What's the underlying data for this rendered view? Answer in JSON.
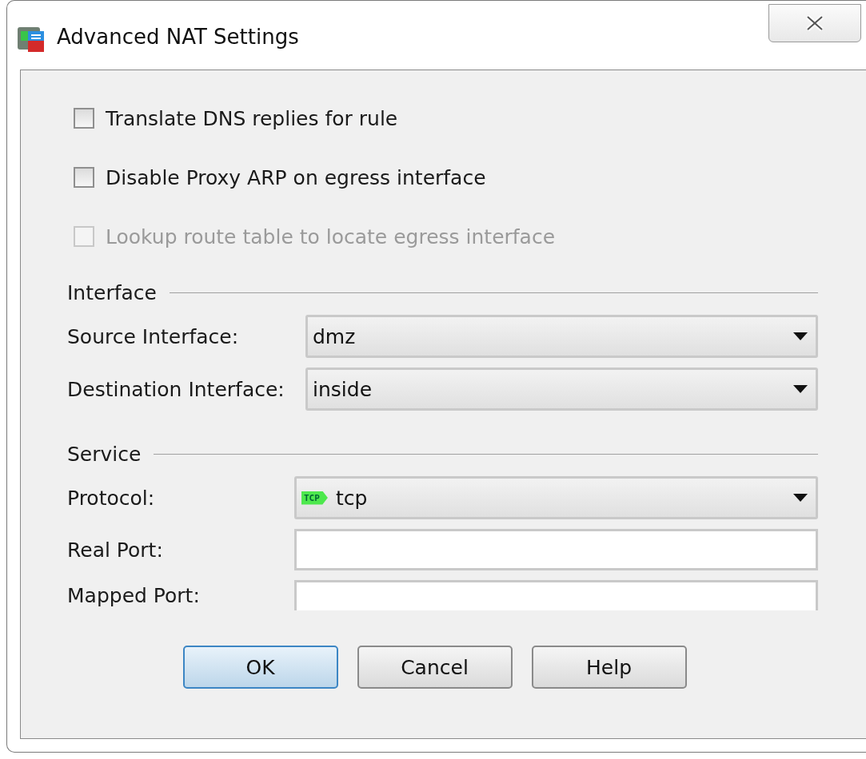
{
  "window": {
    "title": "Advanced NAT Settings"
  },
  "options": [
    {
      "label": "Translate DNS replies for rule",
      "checked": false,
      "disabled": false
    },
    {
      "label": "Disable Proxy ARP on egress interface",
      "checked": false,
      "disabled": false
    },
    {
      "label": "Lookup route table to locate egress interface",
      "checked": false,
      "disabled": true
    }
  ],
  "sections": [
    {
      "title": "Interface",
      "fields": [
        {
          "kind": "combo",
          "label": "Source Interface:",
          "value": "dmz"
        },
        {
          "kind": "combo",
          "label": "Destination Interface:",
          "value": "inside"
        }
      ]
    },
    {
      "title": "Service",
      "fields": [
        {
          "kind": "combo",
          "label": "Protocol:",
          "value": "tcp",
          "badge": "TCP"
        },
        {
          "kind": "text",
          "label": "Real Port:"
        },
        {
          "kind": "text",
          "label": "Mapped Port:"
        }
      ]
    }
  ],
  "buttons": [
    {
      "label": "OK",
      "default": true
    },
    {
      "label": "Cancel",
      "default": false
    },
    {
      "label": "Help",
      "default": false
    }
  ]
}
